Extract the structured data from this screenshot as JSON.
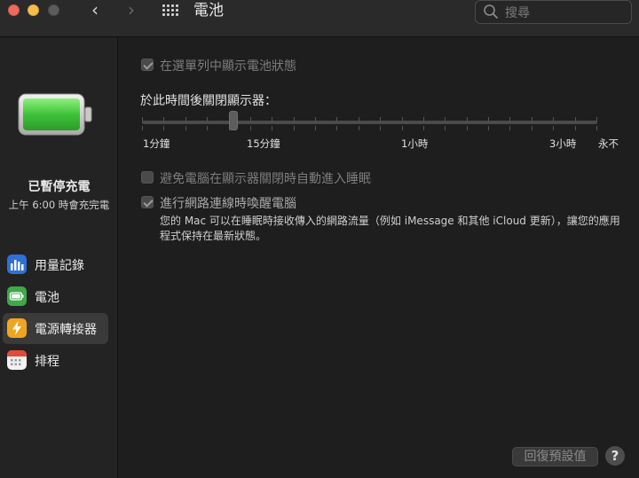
{
  "window": {
    "title": "電池",
    "search_placeholder": "搜尋"
  },
  "sidebar": {
    "status_title": "已暫停充電",
    "status_subtitle": "上午 6:00 時會充完電",
    "items": [
      {
        "label": "用量記錄",
        "icon": "usage-history-icon",
        "color": "#2f6fd8"
      },
      {
        "label": "電池",
        "icon": "battery-icon",
        "color": "#3ea84a"
      },
      {
        "label": "電源轉接器",
        "icon": "power-adapter-icon",
        "color": "#f0a51f"
      },
      {
        "label": "排程",
        "icon": "schedule-icon",
        "color": "#e5e5e5"
      }
    ],
    "selected_index": 2
  },
  "main": {
    "show_battery_status": {
      "label": "在選單列中顯示電池狀態",
      "checked": true,
      "enabled": false
    },
    "display_off_label": "於此時間後關閉顯示器：",
    "slider": {
      "labels": [
        "1分鐘",
        "15分鐘",
        "1小時",
        "3小時",
        "永不"
      ]
    },
    "prevent_sleep": {
      "label": "避免電腦在顯示器關閉時自動進入睡眠",
      "checked": false,
      "enabled": false
    },
    "wake_network": {
      "label": "進行網路連線時喚醒電腦",
      "checked": true,
      "enabled": true,
      "description": "您的 Mac 可以在睡眠時接收傳入的網路流量（例如 iMessage 和其他 iCloud 更新），讓您的應用程式保持在最新狀態。"
    },
    "restore_defaults_label": "回復預設值",
    "help_label": "?"
  },
  "colors": {
    "battery_fill": "#3fc23a",
    "traffic_red": "#ed6a5e",
    "traffic_yellow": "#f5bf4f"
  }
}
